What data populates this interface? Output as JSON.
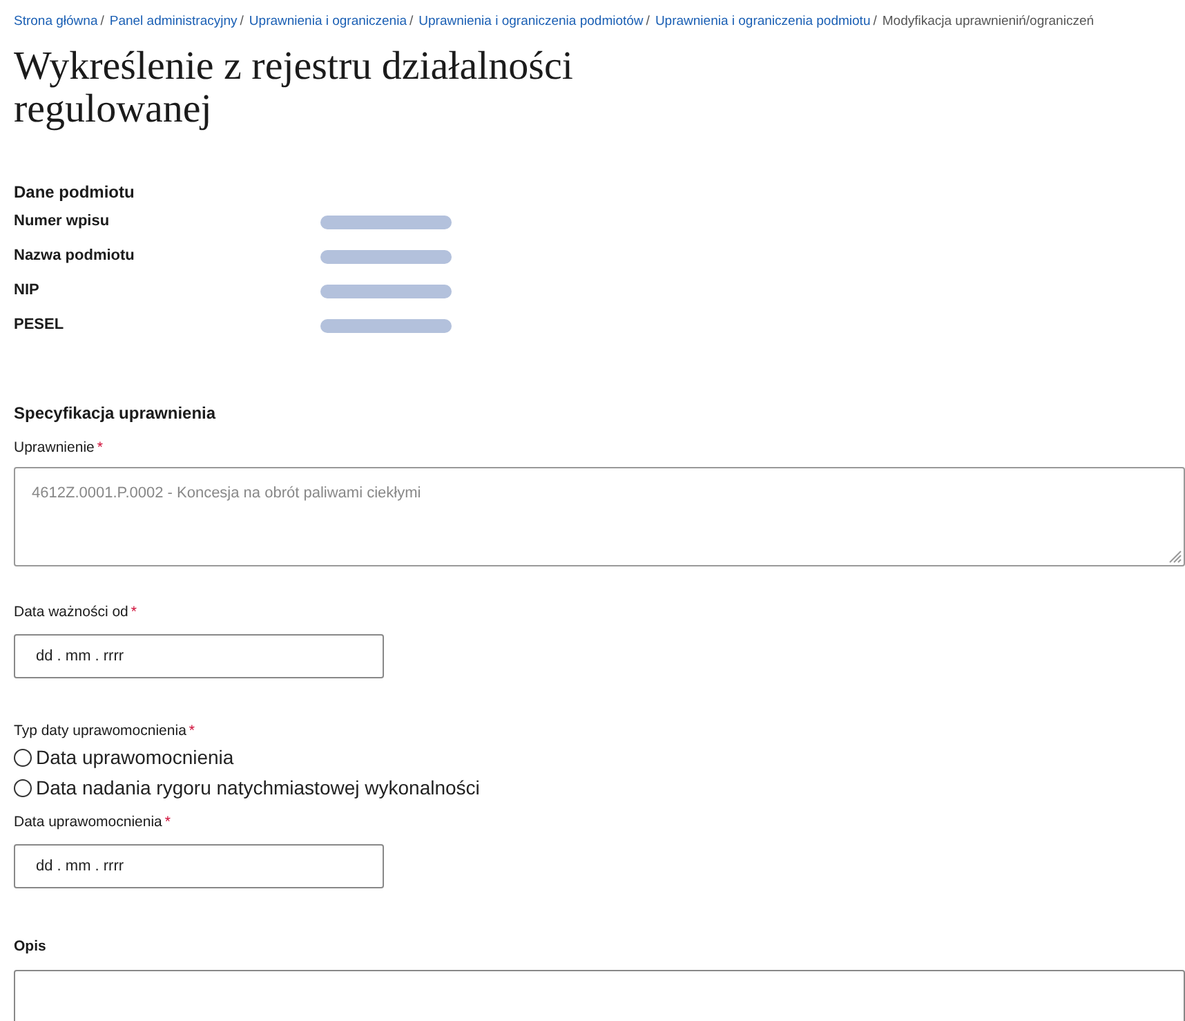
{
  "breadcrumbs": [
    {
      "label": "Strona główna",
      "link": true,
      "separator": "/"
    },
    {
      "label": "Panel administracyjny",
      "link": true,
      "separator": "/"
    },
    {
      "label": "Uprawnienia i ograniczenia",
      "link": true,
      "separator": "/"
    },
    {
      "label": "Uprawnienia i ograniczenia podmiotów",
      "link": true,
      "separator": "/"
    },
    {
      "label": "Uprawnienia i ograniczenia podmiotu",
      "link": true,
      "separator": "/"
    },
    {
      "label": "Modyfikacja uprawnieniń/ograniczeń",
      "link": false
    }
  ],
  "title": "Wykreślenie z rejestru działalności regulowanej",
  "entity": {
    "heading": "Dane podmiotu",
    "fields": [
      {
        "label": "Numer wpisu",
        "redacted": true
      },
      {
        "label": "Nazwa podmiotu",
        "redacted": true
      },
      {
        "label": "NIP",
        "redacted": true
      },
      {
        "label": "PESEL",
        "redacted": true
      }
    ]
  },
  "specification": {
    "heading": "Specyfikacja uprawnienia",
    "permission": {
      "label": "Uprawnienie",
      "required_mark": "*",
      "value": "4612Z.0001.P.0002 - Koncesja na obrót paliwami ciekłymi"
    },
    "valid_from": {
      "label": "Data ważności od",
      "required_mark": "*",
      "placeholder": "dd . mm . rrrr"
    },
    "date_type": {
      "label": "Typ daty uprawomocnienia",
      "required_mark": "*",
      "options": [
        {
          "label": "Data uprawomocnienia",
          "selected": false
        },
        {
          "label": "Data nadania rygoru natychmiastowej wykonalności",
          "selected": false
        }
      ]
    },
    "final_date": {
      "label": "Data uprawomocnienia",
      "required_mark": "*",
      "placeholder": "dd . mm . rrrr"
    },
    "description": {
      "label": "Opis"
    }
  }
}
